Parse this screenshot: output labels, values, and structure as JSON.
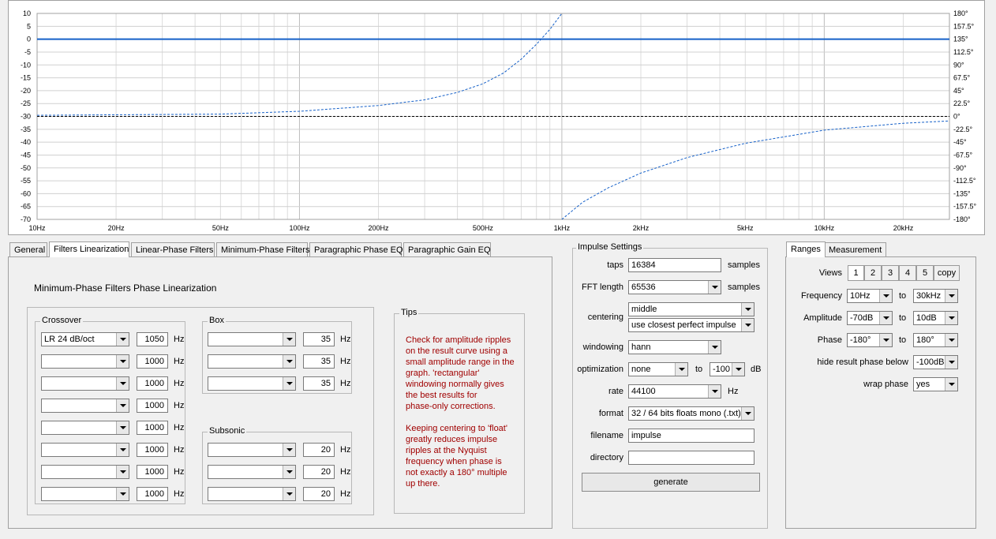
{
  "colors": {
    "accent": "#1560c8",
    "tips": "#a00000",
    "grid": "#d0d0d0",
    "zero_line": "#000000"
  },
  "chart_data": {
    "type": "line",
    "x_scale": "log",
    "xlim": [
      10,
      30000
    ],
    "ylim": [
      -70,
      10
    ],
    "y2lim": [
      -180,
      180
    ],
    "grid": true,
    "x_ticks": [
      {
        "v": 10,
        "label": "10Hz"
      },
      {
        "v": 20,
        "label": "20Hz"
      },
      {
        "v": 50,
        "label": "50Hz"
      },
      {
        "v": 100,
        "label": "100Hz"
      },
      {
        "v": 200,
        "label": "200Hz"
      },
      {
        "v": 500,
        "label": "500Hz"
      },
      {
        "v": 1000,
        "label": "1kHz"
      },
      {
        "v": 2000,
        "label": "2kHz"
      },
      {
        "v": 5000,
        "label": "5kHz"
      },
      {
        "v": 10000,
        "label": "10kHz"
      },
      {
        "v": 20000,
        "label": "20kHz"
      }
    ],
    "y_ticks": [
      "10",
      "5",
      "0",
      "-5",
      "-10",
      "-15",
      "-20",
      "-25",
      "-30",
      "-35",
      "-40",
      "-45",
      "-50",
      "-55",
      "-60",
      "-65",
      "-70"
    ],
    "y2_ticks": [
      "180°",
      "157.5°",
      "135°",
      "112.5°",
      "90°",
      "67.5°",
      "45°",
      "22.5°",
      "0°",
      "-22.5°",
      "-45°",
      "-67.5°",
      "-90°",
      "-112.5°",
      "-135°",
      "-157.5°",
      "-180°"
    ],
    "series": [
      {
        "style": "solid",
        "axis": "left",
        "points": [
          [
            10,
            0
          ],
          [
            30000,
            0
          ]
        ]
      },
      {
        "style": "dashed-black",
        "axis": "right",
        "points": [
          [
            10,
            0
          ],
          [
            30000,
            0
          ]
        ]
      },
      {
        "style": "dashed-blue",
        "axis": "right",
        "points": [
          [
            10,
            2
          ],
          [
            50,
            4
          ],
          [
            100,
            9
          ],
          [
            200,
            19
          ],
          [
            300,
            29
          ],
          [
            400,
            42
          ],
          [
            500,
            57
          ],
          [
            600,
            76
          ],
          [
            700,
            100
          ],
          [
            800,
            126
          ],
          [
            900,
            152
          ],
          [
            1000,
            180
          ]
        ]
      },
      {
        "style": "dashed-blue",
        "axis": "right",
        "points": [
          [
            1000,
            -180
          ],
          [
            1200,
            -150
          ],
          [
            1500,
            -125
          ],
          [
            2000,
            -99
          ],
          [
            3000,
            -72
          ],
          [
            5000,
            -47
          ],
          [
            10000,
            -24
          ],
          [
            20000,
            -12
          ],
          [
            30000,
            -8
          ]
        ]
      }
    ]
  },
  "tabs": [
    "General",
    "Filters Linearization",
    "Linear-Phase Filters",
    "Minimum-Phase Filters",
    "Paragraphic Phase EQ",
    "Paragraphic Gain EQ"
  ],
  "linearization": {
    "title": "Minimum-Phase Filters Phase Linearization",
    "crossover_title": "Crossover",
    "box_title": "Box",
    "subsonic_title": "Subsonic",
    "hz": "Hz",
    "crossover": [
      {
        "type": "LR  24 dB/oct",
        "freq": "1050"
      },
      {
        "type": "",
        "freq": "1000"
      },
      {
        "type": "",
        "freq": "1000"
      },
      {
        "type": "",
        "freq": "1000"
      },
      {
        "type": "",
        "freq": "1000"
      },
      {
        "type": "",
        "freq": "1000"
      },
      {
        "type": "",
        "freq": "1000"
      },
      {
        "type": "",
        "freq": "1000"
      }
    ],
    "box": [
      {
        "type": "",
        "freq": "35"
      },
      {
        "type": "",
        "freq": "35"
      },
      {
        "type": "",
        "freq": "35"
      }
    ],
    "subsonic": [
      {
        "type": "",
        "freq": "20"
      },
      {
        "type": "",
        "freq": "20"
      },
      {
        "type": "",
        "freq": "20"
      }
    ],
    "tips_title": "Tips",
    "tips_text": "Check for amplitude ripples\non the result curve using a\nsmall amplitude range in the\ngraph. 'rectangular'\nwindowing normally gives\nthe best results for\nphase-only corrections.\n\nKeeping centering to 'float'\ngreatly reduces impulse\nripples at the Nyquist\nfrequency when phase is\nnot exactly a 180° multiple\nup there."
  },
  "impulse": {
    "title": "Impulse Settings",
    "taps_label": "taps",
    "taps": "16384",
    "samples": "samples",
    "fft_label": "FFT length",
    "fft": "65536",
    "centering_label": "centering",
    "centering": "middle",
    "centering2": "use closest perfect impulse",
    "windowing_label": "windowing",
    "windowing": "hann",
    "optimization_label": "optimization",
    "optimization": "none",
    "to": "to",
    "opt_to": "-100",
    "db": "dB",
    "rate_label": "rate",
    "rate": "44100",
    "hz": "Hz",
    "format_label": "format",
    "format": "32 / 64 bits floats mono (.txt)",
    "filename_label": "filename",
    "filename": "impulse",
    "directory_label": "directory",
    "directory": "",
    "generate": "generate"
  },
  "ranges": {
    "tabs": [
      "Ranges",
      "Measurement"
    ],
    "views_label": "Views",
    "views": [
      "1",
      "2",
      "3",
      "4",
      "5"
    ],
    "copy": "copy",
    "frequency_label": "Frequency",
    "freq_from": "10Hz",
    "freq_to": "30kHz",
    "amplitude_label": "Amplitude",
    "amp_from": "-70dB",
    "amp_to": "10dB",
    "phase_label": "Phase",
    "phase_from": "-180°",
    "phase_to": "180°",
    "hide_label": "hide result phase below",
    "hide": "-100dB",
    "wrap_label": "wrap phase",
    "wrap": "yes",
    "to": "to"
  }
}
